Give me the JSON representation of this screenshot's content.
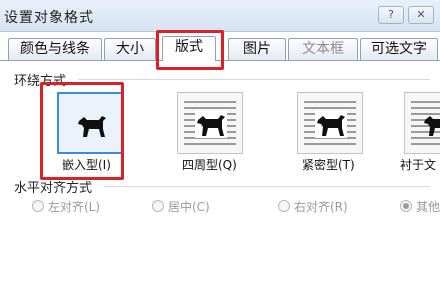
{
  "dialog": {
    "title": "设置对象格式"
  },
  "tabs": [
    {
      "label": "颜色与线条",
      "state": "normal"
    },
    {
      "label": "大小",
      "state": "normal"
    },
    {
      "label": "版式",
      "state": "active"
    },
    {
      "label": "图片",
      "state": "normal"
    },
    {
      "label": "文本框",
      "state": "disabled"
    },
    {
      "label": "可选文字",
      "state": "normal"
    }
  ],
  "wrap_section": {
    "title": "环绕方式",
    "options": [
      {
        "label": "嵌入型(I)",
        "icon": "dog-inline-icon",
        "selected": true
      },
      {
        "label": "四周型(Q)",
        "icon": "dog-square-icon",
        "selected": false
      },
      {
        "label": "紧密型(T)",
        "icon": "dog-tight-icon",
        "selected": false
      },
      {
        "label": "衬于文",
        "icon": "dog-behind-icon",
        "selected": false
      }
    ]
  },
  "align_section": {
    "title": "水平对齐方式",
    "options": [
      {
        "label": "左对齐(L)",
        "checked": false
      },
      {
        "label": "居中(C)",
        "checked": false
      },
      {
        "label": "右对齐(R)",
        "checked": false
      },
      {
        "label": "其他",
        "checked": true
      }
    ]
  },
  "colors": {
    "highlight": "#d8212a",
    "selected_border": "#3c8ad8"
  }
}
